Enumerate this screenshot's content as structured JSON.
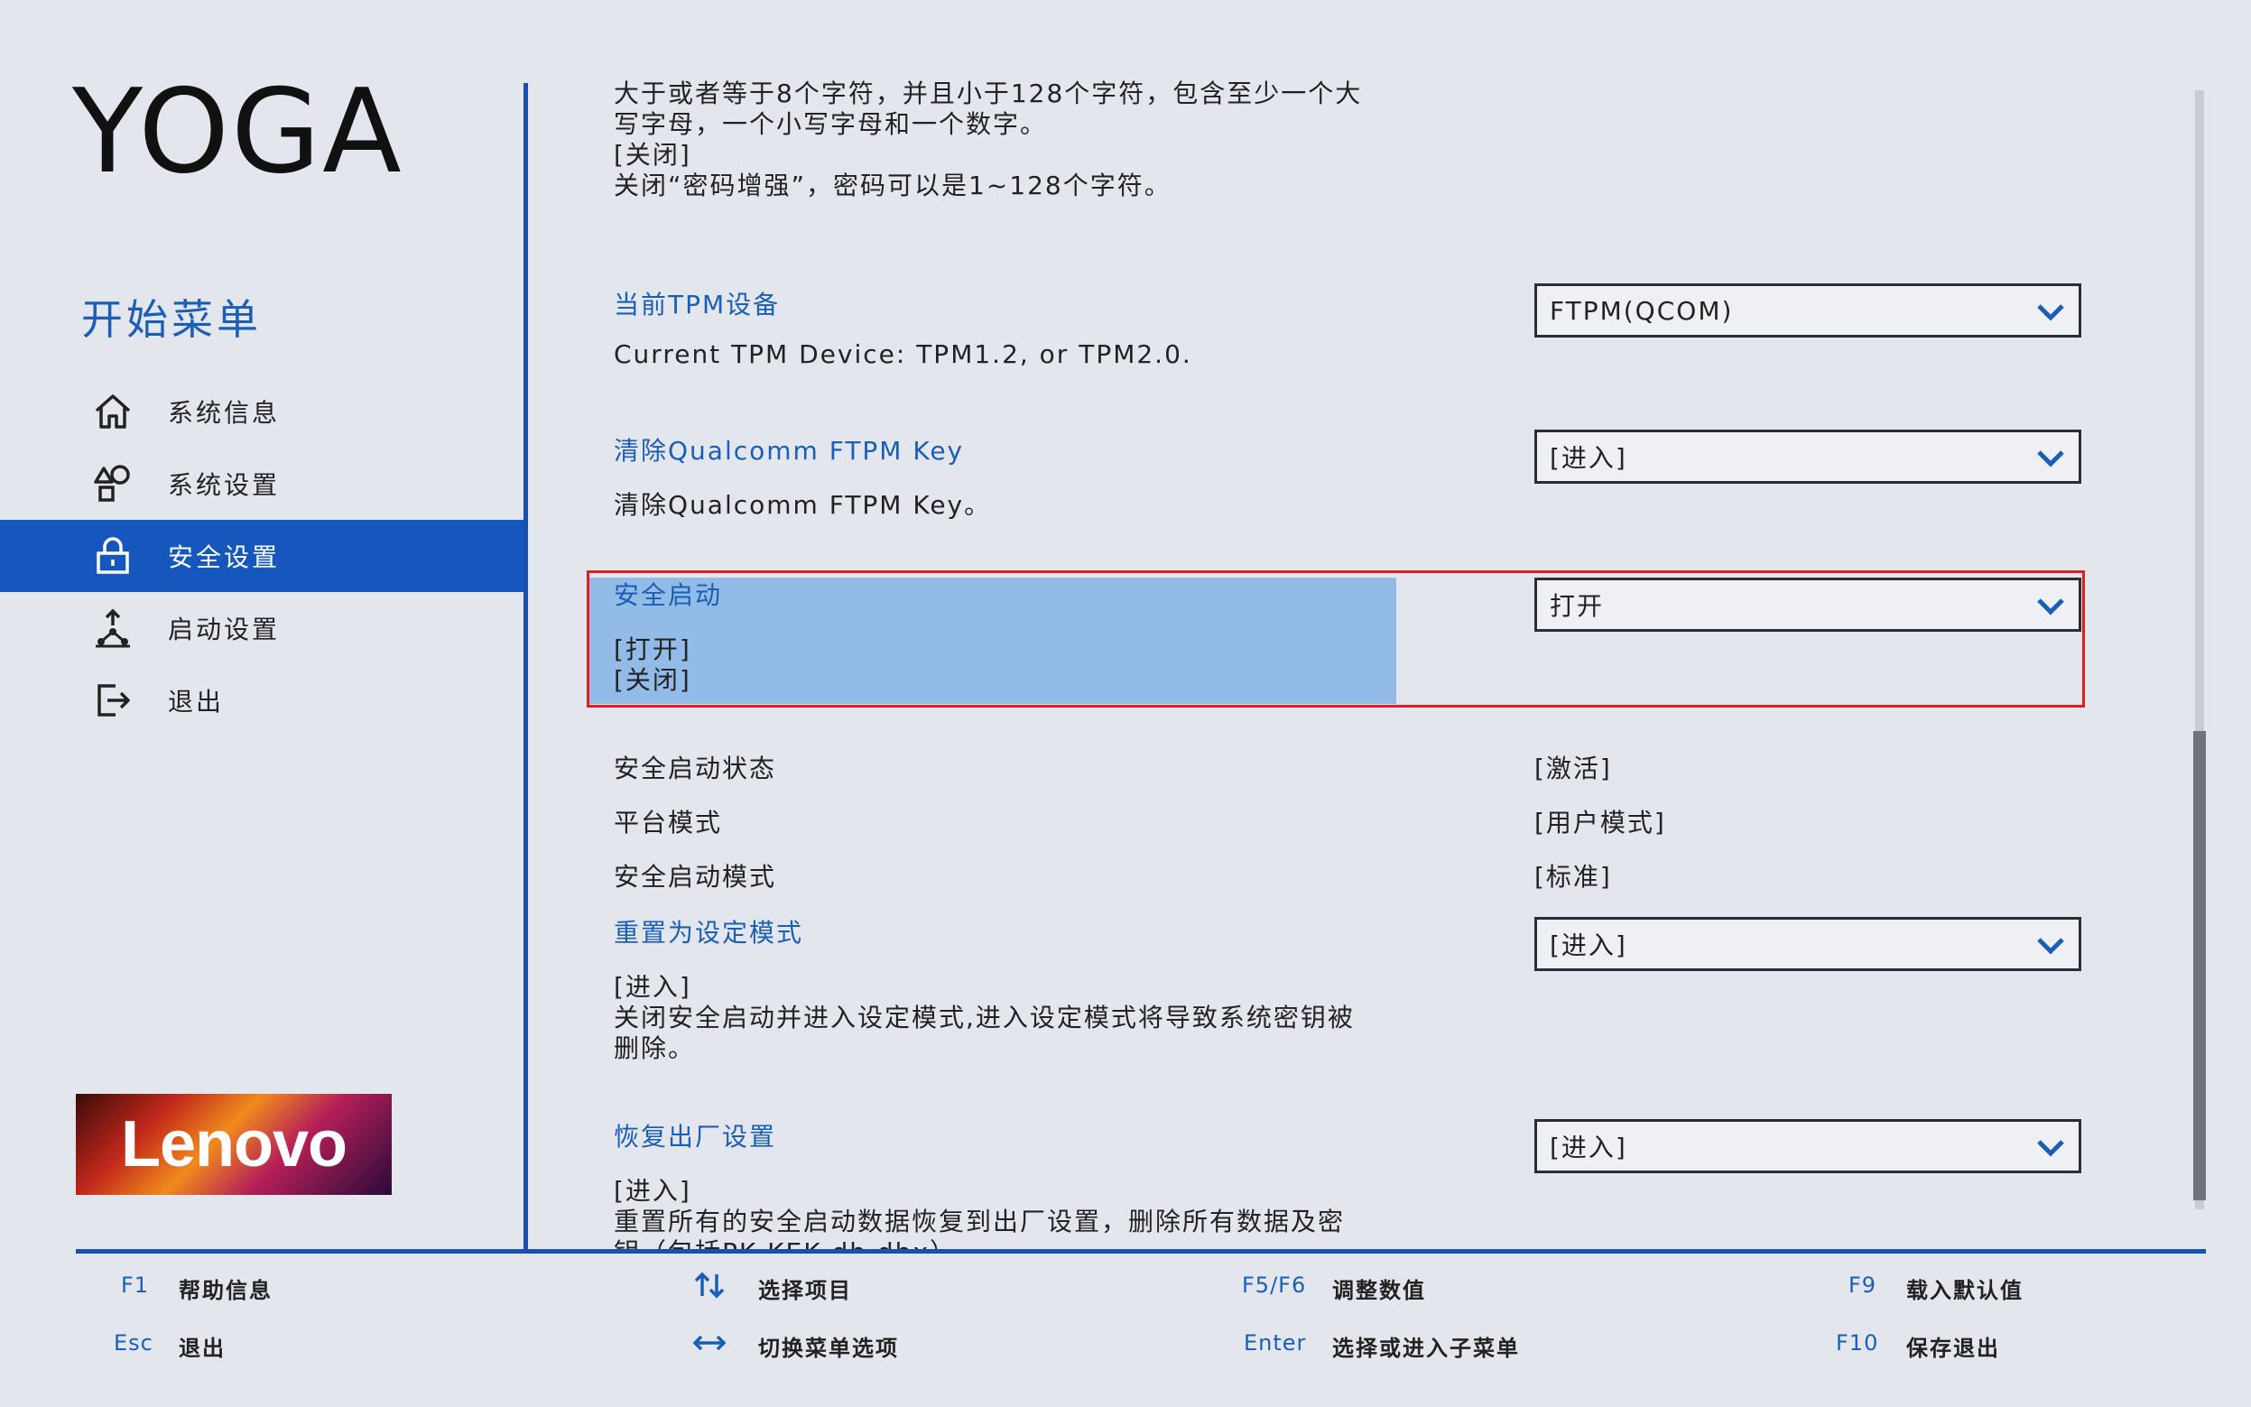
{
  "brand": {
    "logo_text": "YOGA",
    "badge_text": "Lenovo"
  },
  "sidebar": {
    "title": "开始菜单",
    "items": [
      {
        "label": "系统信息",
        "icon": "home-icon"
      },
      {
        "label": "系统设置",
        "icon": "shapes-icon"
      },
      {
        "label": "安全设置",
        "icon": "lock-icon",
        "active": true
      },
      {
        "label": "启动设置",
        "icon": "boot-icon"
      },
      {
        "label": "退出",
        "icon": "exit-icon"
      }
    ]
  },
  "main": {
    "top_text": {
      "line1": "大于或者等于8个字符，并且小于128个字符，包含至少一个大",
      "line2": "写字母，一个小写字母和一个数字。",
      "line3": "[关闭]",
      "line4": "关闭“密码增强”，密码可以是1~128个字符。"
    },
    "tpm": {
      "title": "当前TPM设备",
      "desc": "Current TPM Device: TPM1.2, or TPM2.0.",
      "value": "FTPM(QCOM)"
    },
    "clear_key": {
      "title": "清除Qualcomm FTPM Key",
      "desc": "清除Qualcomm FTPM Key。",
      "value": "[进入]"
    },
    "secure_boot": {
      "title": "安全启动",
      "opt1": "[打开]",
      "opt2": "[关闭]",
      "value": "打开"
    },
    "status": [
      {
        "label": "安全启动状态",
        "value": "[激活]"
      },
      {
        "label": "平台模式",
        "value": "[用户模式]"
      },
      {
        "label": "安全启动模式",
        "value": "[标准]"
      }
    ],
    "reset_setup": {
      "title": "重置为设定模式",
      "line1": "[进入]",
      "line2": "关闭安全启动并进入设定模式,进入设定模式将导致系统密钥被",
      "line3": "删除。",
      "value": "[进入]"
    },
    "factory": {
      "title": "恢复出厂设置",
      "line1": "[进入]",
      "line2": "重置所有的安全启动数据恢复到出厂设置，删除所有数据及密",
      "line3": "钥（包括PK,KEK,db,dbx）",
      "value": "[进入]"
    }
  },
  "footer": {
    "f1_key": "F1",
    "f1_desc": "帮助信息",
    "esc_key": "Esc",
    "esc_desc": "退出",
    "select_desc": "选择项目",
    "switch_desc": "切换菜单选项",
    "f56_key": "F5/F6",
    "f56_desc": "调整数值",
    "enter_key": "Enter",
    "enter_desc": "选择或进入子菜单",
    "f9_key": "F9",
    "f9_desc": "载入默认值",
    "f10_key": "F10",
    "f10_desc": "保存退出"
  },
  "colors": {
    "accent": "#1657bd",
    "highlight": "#93bbe7",
    "focus_border": "#e02020",
    "background": "#e3e6ec"
  }
}
